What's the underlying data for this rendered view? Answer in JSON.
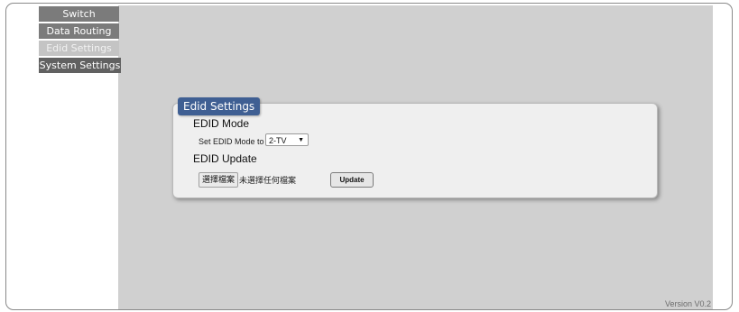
{
  "sidebar": {
    "items": [
      {
        "label": "Switch"
      },
      {
        "label": "Data Routing"
      },
      {
        "label": "Edid Settings"
      },
      {
        "label": "System Settings"
      }
    ]
  },
  "panel": {
    "title": "Edid Settings",
    "edid_mode_heading": "EDID Mode",
    "set_mode_label": "Set EDID Mode to",
    "mode_value": "2-TV",
    "edid_update_heading": "EDID Update",
    "choose_file_label": "選擇檔案",
    "file_status": "未選擇任何檔案",
    "update_label": "Update"
  },
  "footer": {
    "version": "Version V0.2"
  }
}
